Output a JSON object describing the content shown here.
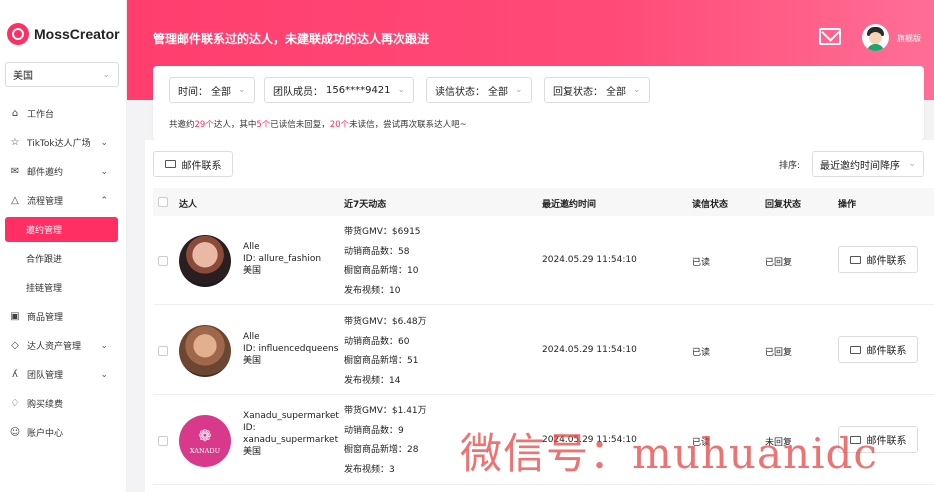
{
  "app": {
    "name": "MossCreator",
    "region": "美国"
  },
  "sidebar": {
    "items": [
      {
        "label": "工作台",
        "icon": "home-icon"
      },
      {
        "label": "TikTok达人广场",
        "icon": "star-icon",
        "caret": "⌄"
      },
      {
        "label": "邮件邀约",
        "icon": "mail-icon",
        "caret": "⌄"
      },
      {
        "label": "流程管理",
        "icon": "flow-icon",
        "caret": "⌃"
      },
      {
        "label": "商品管理",
        "icon": "goods-icon"
      },
      {
        "label": "达人资产管理",
        "icon": "asset-icon",
        "caret": "⌄"
      },
      {
        "label": "团队管理",
        "icon": "team-icon",
        "caret": "⌄"
      },
      {
        "label": "购买续费",
        "icon": "diamond-icon"
      },
      {
        "label": "账户中心",
        "icon": "account-icon"
      }
    ],
    "sub_items": [
      "邀约管理",
      "合作跟进",
      "挂链管理"
    ],
    "active_sub": "邀约管理"
  },
  "header": {
    "title": "管理邮件联系过的达人，未建联成功的达人再次跟进",
    "plan": "旗舰版"
  },
  "filters": [
    {
      "label": "时间：",
      "value": "全部"
    },
    {
      "label": "团队成员：",
      "value": "156****9421"
    },
    {
      "label": "读信状态：",
      "value": "全部"
    },
    {
      "label": "回复状态：",
      "value": "全部"
    }
  ],
  "summary": {
    "p1": "共邀约",
    "n1": "29个",
    "p2": "达人，其中",
    "n2": "5个",
    "p3": "已读信未回复，",
    "n3": "20个",
    "p4": "未读信，尝试再次联系达人吧~"
  },
  "toolbar": {
    "email_button": "邮件联系",
    "sort_label": "排序:",
    "sort_value": "最近邀约时间降序"
  },
  "table": {
    "headers": {
      "creator": "达人",
      "activity": "近7天动态",
      "time": "最近邀约时间",
      "read": "读信状态",
      "reply": "回复状态",
      "action": "操作"
    },
    "rows": [
      {
        "name": "Alle",
        "id": "ID: allure_fashion",
        "country": "美国",
        "gmv": "带货GMV：$6915",
        "sales": "动销商品数：58",
        "window": "橱窗商品新增：10",
        "videos": "发布视频：10",
        "time": "2024.05.29 11:54:10",
        "read": "已读",
        "reply": "已回复",
        "action": "邮件联系"
      },
      {
        "name": "Alle",
        "id": "ID: influencedqueens",
        "country": "美国",
        "gmv": "带货GMV：$6.48万",
        "sales": "动销商品数：60",
        "window": "橱窗商品新增：51",
        "videos": "发布视频：14",
        "time": "2024.05.29 11:54:10",
        "read": "已读",
        "reply": "已回复",
        "action": "邮件联系"
      },
      {
        "name": "Xanadu_supermarket",
        "id_label": "ID:",
        "id": "xanadu_supermarket",
        "country": "美国",
        "gmv": "带货GMV：$1.41万",
        "sales": "动销商品数：9",
        "window": "橱窗商品新增：28",
        "videos": "发布视频：3",
        "time": "2024.05.29 11:54:10",
        "read": "已读",
        "reply": "未回复",
        "action": "邮件联系",
        "logo_text": "XANADU"
      }
    ]
  },
  "watermark": "微信号：muhuanidc",
  "colors": {
    "accent": "#ff2f63"
  }
}
